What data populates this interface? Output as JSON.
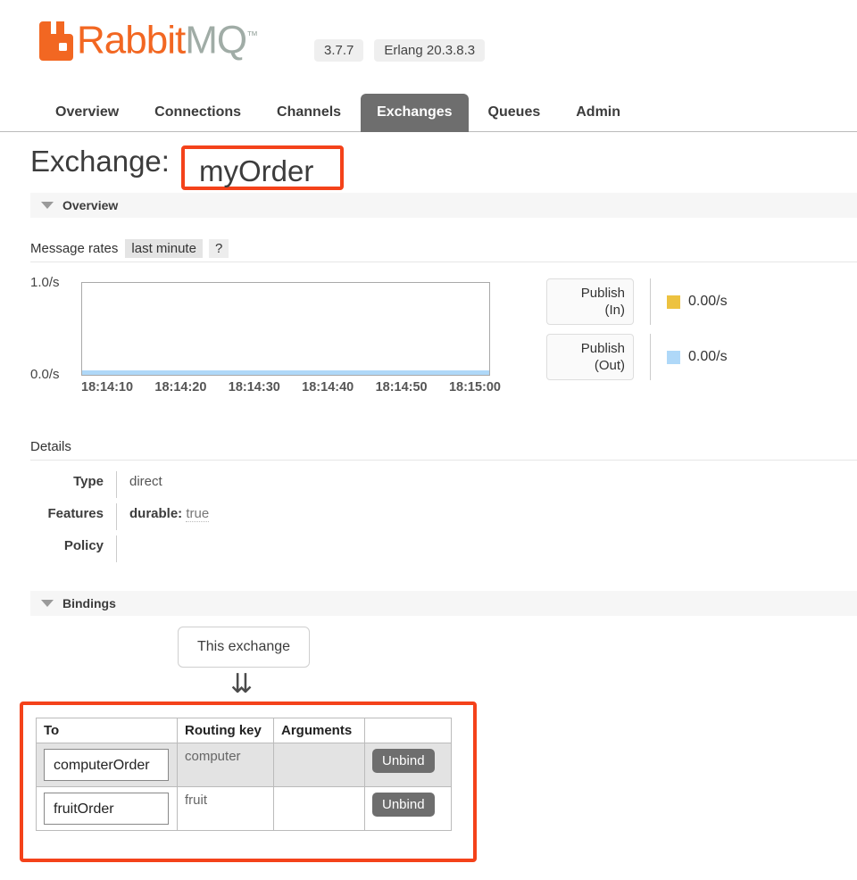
{
  "header": {
    "logo_rabbit": "Rabbit",
    "logo_mq": "MQ",
    "logo_tm": "™",
    "version_badge": "3.7.7",
    "erlang_badge": "Erlang 20.3.8.3",
    "brand_color": "#F26722"
  },
  "tabs": [
    {
      "label": "Overview",
      "active": false
    },
    {
      "label": "Connections",
      "active": false
    },
    {
      "label": "Channels",
      "active": false
    },
    {
      "label": "Exchanges",
      "active": true
    },
    {
      "label": "Queues",
      "active": false
    },
    {
      "label": "Admin",
      "active": false
    }
  ],
  "page": {
    "title_prefix": "Exchange:",
    "exchange_name": "myOrder",
    "highlight_color": "#F4421A"
  },
  "overview": {
    "section_label": "Overview",
    "message_rates_label": "Message rates",
    "period_chip": "last minute",
    "help_chip": "?"
  },
  "chart_data": {
    "type": "line",
    "title": "Message rates",
    "xlabel": "",
    "ylabel": "",
    "ylim": [
      0.0,
      1.0
    ],
    "y_ticks": [
      "0.0/s",
      "1.0/s"
    ],
    "x": [
      "18:14:10",
      "18:14:20",
      "18:14:30",
      "18:14:40",
      "18:14:50",
      "18:15:00"
    ],
    "grid": false,
    "legend_position": "right",
    "series": [
      {
        "name": "Publish (In)",
        "color": "#EDC240",
        "rate": "0.00/s",
        "values": [
          0,
          0,
          0,
          0,
          0,
          0
        ]
      },
      {
        "name": "Publish (Out)",
        "color": "#AFD8F8",
        "rate": "0.00/s",
        "values": [
          0,
          0,
          0,
          0,
          0,
          0
        ]
      }
    ]
  },
  "legend": [
    {
      "button_line1": "Publish",
      "button_line2": "(In)",
      "color": "#EDC240",
      "value": "0.00/s"
    },
    {
      "button_line1": "Publish",
      "button_line2": "(Out)",
      "color": "#AFD8F8",
      "value": "0.00/s"
    }
  ],
  "details": {
    "title": "Details",
    "rows": [
      {
        "key": "Type",
        "value": "direct"
      },
      {
        "key": "Features",
        "feature_key": "durable:",
        "feature_value": "true"
      },
      {
        "key": "Policy",
        "value": ""
      }
    ]
  },
  "bindings": {
    "section_label": "Bindings",
    "this_exchange_label": "This exchange",
    "arrow_glyph": "⇊",
    "columns": [
      "To",
      "Routing key",
      "Arguments",
      ""
    ],
    "rows": [
      {
        "to": "computerOrder",
        "routing_key": "computer",
        "arguments": "",
        "action": "Unbind"
      },
      {
        "to": "fruitOrder",
        "routing_key": "fruit",
        "arguments": "",
        "action": "Unbind"
      }
    ]
  }
}
